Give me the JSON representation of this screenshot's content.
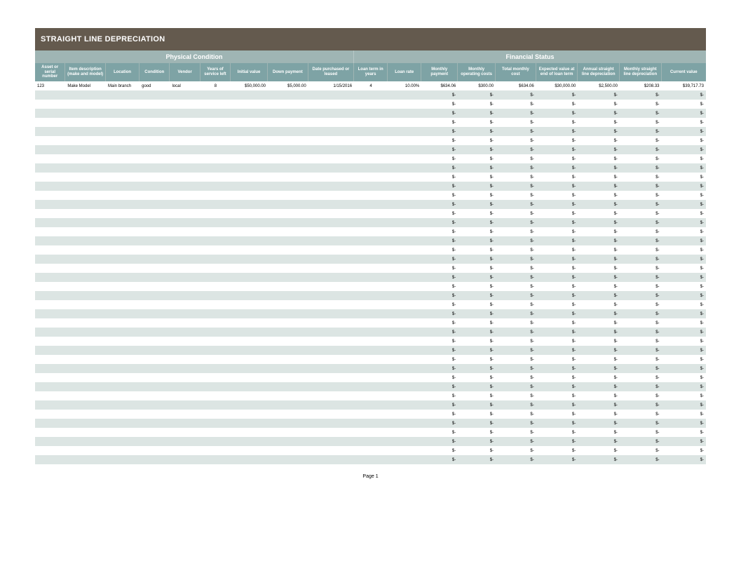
{
  "title": "STRAIGHT LINE DEPRECIATION",
  "sections": {
    "physical": "Physical Condition",
    "financial": "Financial Status"
  },
  "columns": [
    {
      "key": "asset_serial",
      "label": "Asset or serial number",
      "align": "l"
    },
    {
      "key": "item_desc",
      "label": "Item description (make and model)",
      "align": "l"
    },
    {
      "key": "location",
      "label": "Location",
      "align": "l"
    },
    {
      "key": "condition",
      "label": "Condition",
      "align": "l"
    },
    {
      "key": "vendor",
      "label": "Vendor",
      "align": "l"
    },
    {
      "key": "years_left",
      "label": "Years of service left",
      "align": "c"
    },
    {
      "key": "initial_value",
      "label": "Initial value",
      "align": "r"
    },
    {
      "key": "down_payment",
      "label": "Down payment",
      "align": "r"
    },
    {
      "key": "date",
      "label": "Date purchased or leased",
      "align": "r"
    },
    {
      "key": "loan_term",
      "label": "Loan term in years",
      "align": "c"
    },
    {
      "key": "loan_rate",
      "label": "Loan rate",
      "align": "r"
    },
    {
      "key": "monthly_payment",
      "label": "Monthly payment",
      "align": "r"
    },
    {
      "key": "monthly_op",
      "label": "Monthly operating costs",
      "align": "r"
    },
    {
      "key": "total_monthly",
      "label": "Total monthly cost",
      "align": "r"
    },
    {
      "key": "expected_end",
      "label": "Expected value at end of loan term",
      "align": "r"
    },
    {
      "key": "annual_dep",
      "label": "Annual straight line depreciation",
      "align": "r"
    },
    {
      "key": "monthly_dep",
      "label": "Monthly straight line depreciation",
      "align": "r"
    },
    {
      "key": "current_value",
      "label": "Current value",
      "align": "r"
    }
  ],
  "first_row": {
    "asset_serial": "123",
    "item_desc": "Make Model",
    "location": "Main branch",
    "condition": "good",
    "vendor": "local",
    "years_left": "8",
    "initial_value": "$50,000.00",
    "down_payment": "$5,000.00",
    "date": "1/15/2016",
    "loan_term": "4",
    "loan_rate": "10.00%",
    "monthly_payment": "$634.06",
    "monthly_op": "$300.00",
    "total_monthly": "$634.06",
    "expected_end": "$30,000.00",
    "annual_dep": "$2,500.00",
    "monthly_dep": "$208.33",
    "current_value": "$39,717.73"
  },
  "empty_marker": "$-",
  "empty_rows": 41,
  "footer": "Page 1"
}
